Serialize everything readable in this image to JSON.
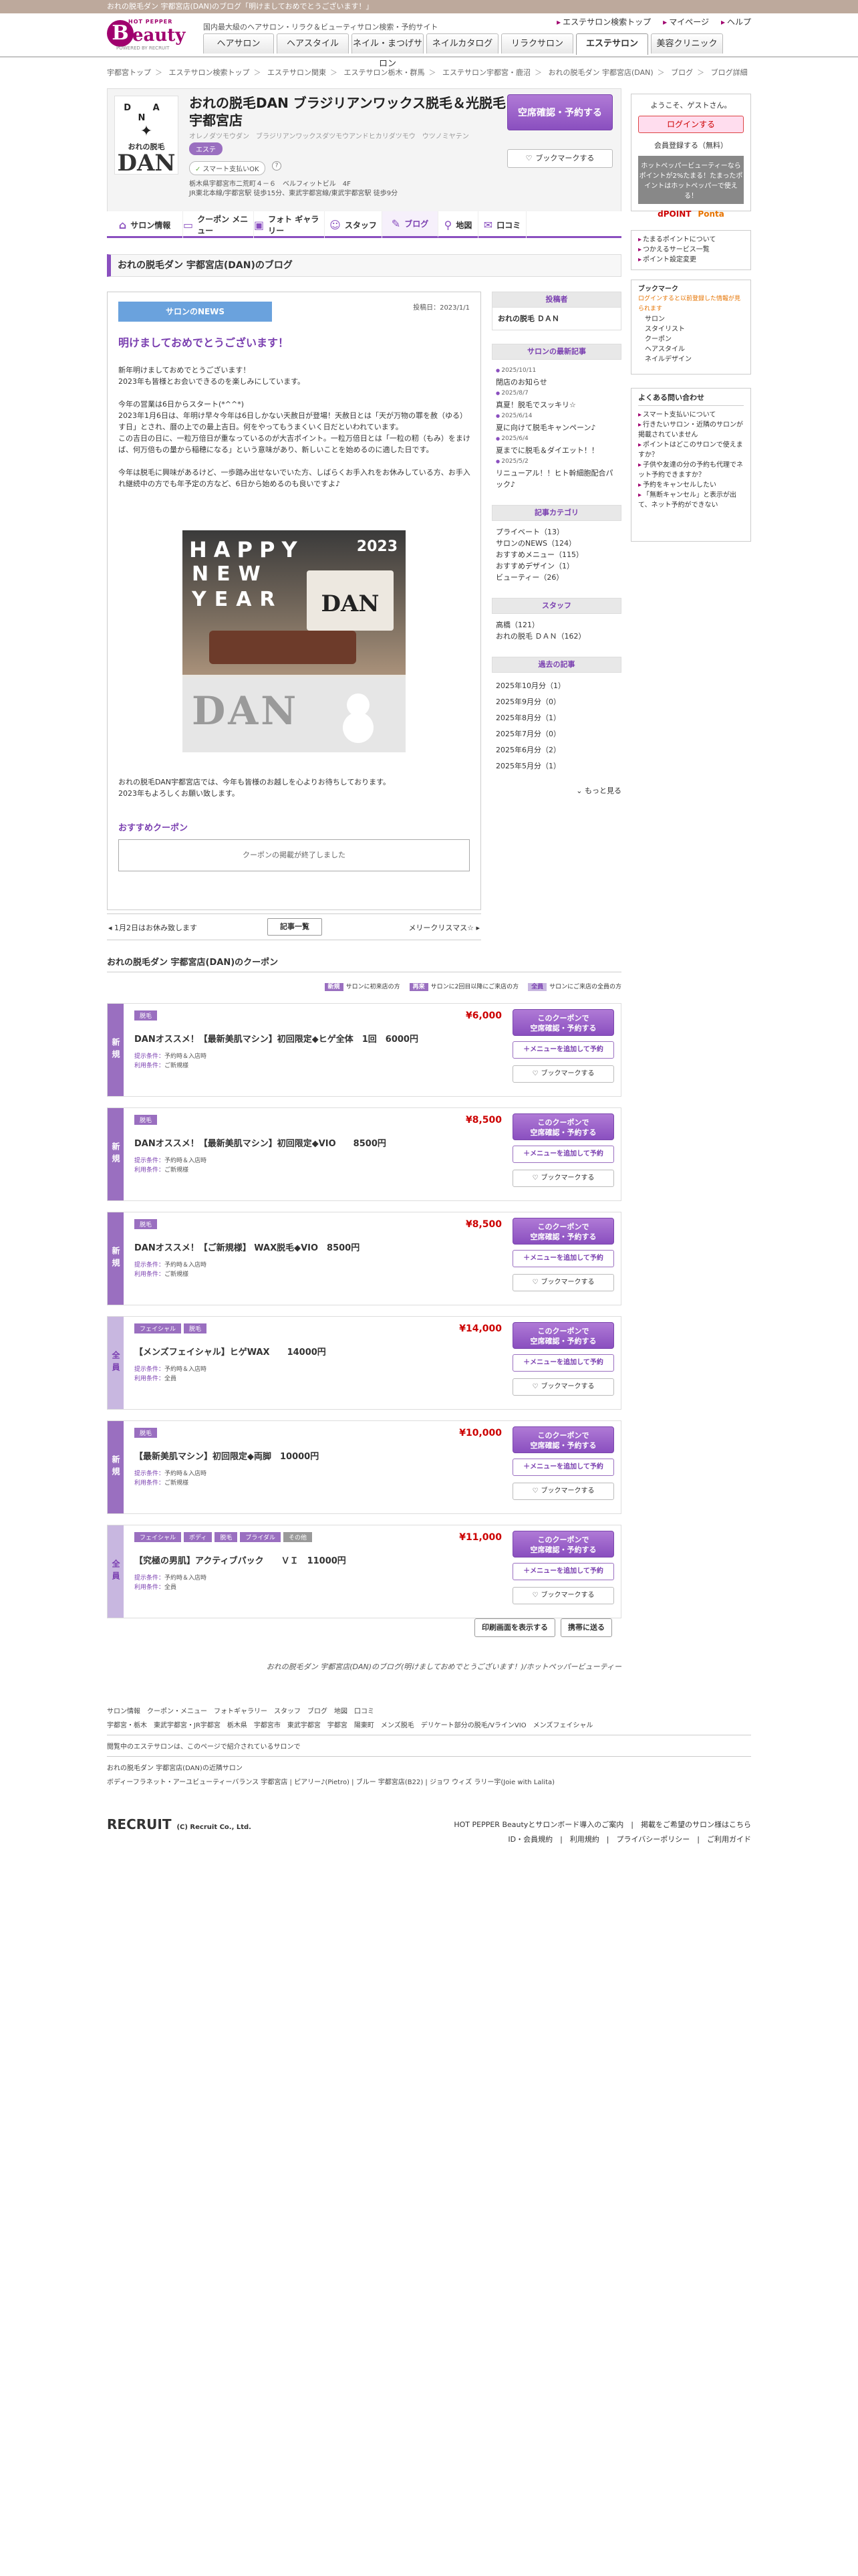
{
  "topbar": "おれの脱毛ダン 宇都宮店(DAN)のブログ「明けましておめでとうございます！」",
  "logo": {
    "hp": "HOT PEPPER",
    "beauty": "eauty",
    "b": "B",
    "powered": "POWERED BY RECRUIT"
  },
  "catch": "国内最大級のヘアサロン・リラク＆ビューティサロン検索・予約サイト",
  "headlinks": [
    "エステサロン検索トップ",
    "マイページ",
    "ヘルプ"
  ],
  "gnav": [
    "ヘアサロン",
    "ヘアスタイル",
    "ネイル・まつげサロン",
    "ネイルカタログ",
    "リラクサロン",
    "エステサロン",
    "美容クリニック"
  ],
  "breadcrumb": [
    "宇都宮トップ",
    "エステサロン検索トップ",
    "エステサロン関東",
    "エステサロン栃木・群馬",
    "エステサロン宇都宮・鹿沼",
    "おれの脱毛ダン 宇都宮店(DAN)",
    "ブログ",
    "ブログ詳細"
  ],
  "salon": {
    "name": "おれの脱毛DAN ブラジリアンワックス脱毛＆光脱毛 宇都宮店",
    "kana": "オレノダツモウダン　ブラジリアンワックスダツモウアンドヒカリダツモウ　ウツノミヤテン",
    "tag": "エステ",
    "smartpay": "スマート支払いOK",
    "address": "栃木県宇都宮市二荒町４－６　ベルフィットビル　4F",
    "access": "JR東北本線/宇都宮駅 徒歩15分、東武宇都宮線/東武宇都宮駅 徒歩9分",
    "reserve": "空席確認・予約する",
    "bookmark": "ブックマークする",
    "logo_top": "D A N",
    "logo_ore": "おれの脱毛",
    "logo_dan": "DAN"
  },
  "tabs": [
    {
      "label": "サロン情報",
      "icon": "⌂"
    },
    {
      "label": "クーポン メニュー",
      "icon": "▭"
    },
    {
      "label": "フォト ギャラリー",
      "icon": "▣"
    },
    {
      "label": "スタッフ",
      "icon": "☺"
    },
    {
      "label": "ブログ",
      "icon": "✎"
    },
    {
      "label": "地図",
      "icon": "⚲"
    },
    {
      "label": "口コミ",
      "icon": "✉"
    }
  ],
  "blog_heading": "おれの脱毛ダン 宇都宮店(DAN)のブログ",
  "article": {
    "category": "サロンのNEWS",
    "date": "投稿日：2023/1/1",
    "title": "明けましておめでとうございます！",
    "body": "新年明けましておめでとうございます！\n2023年も皆様とお会いできるのを楽しみにしています。\n\n今年の営業は6日からスタート(*^^*)\n2023年1月6日は、年明け早々今年は6日しかない天赦日が登場！天赦日とは「天が万物の罪を赦（ゆる）す日」とされ、暦の上での最上吉日。何をやってもうまくいく日だといわれています。\nこの吉日の日に、一粒万倍日が重なっているのが大吉ポイント。一粒万倍日とは「一粒の籾（もみ）をまけば、何万倍もの量から稲穂になる」という意味があり、新しいことを始めるのに適した日です。\n\n今年は脱毛に興味があるけど、一歩踏み出せないでいた方、しばらくお手入れをお休みしている方、お手入れ継続中の方でも年予定の方など、6日から始めるのも良いですよ♪",
    "photo": {
      "happy": "HAPPY",
      "new": "NEW",
      "year_word": "YEAR",
      "year": "2023",
      "sign": "DAN",
      "board": "DAN"
    },
    "footer": "おれの脱毛DAN宇都宮店では、今年も皆様のお越しを心よりお待ちしております。\n2023年もよろしくお願い致します。",
    "coupon_title": "おすすめクーポン",
    "coupon_ended": "クーポンの掲載が終了しました"
  },
  "pager": {
    "prev": "1月2日はお休み致します",
    "list": "記事一覧",
    "next": "メリークリスマス☆"
  },
  "sidebar": {
    "author_h": "投稿者",
    "author": "おれの脱毛 ＤＡＮ",
    "latest_h": "サロンの最新記事",
    "latest": [
      {
        "date": "2025/10/11",
        "title": "閉店のお知らせ"
      },
      {
        "date": "2025/8/7",
        "title": "真夏！脱毛でスッキリ☆"
      },
      {
        "date": "2025/6/14",
        "title": "夏に向けて脱毛キャンペーン♪"
      },
      {
        "date": "2025/6/4",
        "title": "夏までに脱毛＆ダイエット！！"
      },
      {
        "date": "2025/5/2",
        "title": "リニューアル！！ヒト幹細胞配合パック♪"
      }
    ],
    "cat_h": "記事カテゴリ",
    "cats": [
      "プライベート（13）",
      "サロンのNEWS（124）",
      "おすすめメニュー（115）",
      "おすすめデザイン（1）",
      "ビューティー（26）"
    ],
    "staff_h": "スタッフ",
    "staff": [
      "高橋（121）",
      "おれの脱毛 ＤＡＮ（162）"
    ],
    "past_h": "過去の記事",
    "past": [
      "2025年10月分（1）",
      "2025年9月分（0）",
      "2025年8月分（1）",
      "2025年7月分（0）",
      "2025年6月分（2）",
      "2025年5月分（1）"
    ],
    "more": "もっと見る"
  },
  "right": {
    "welcome": "ようこそ、ゲストさん。",
    "login": "ログインする",
    "register": "会員登録する（無料）",
    "promo": "ホットペッパービューティーならポイントが2%たまる！たまったポイントはホットペッパーで使える！",
    "pt1": "Ponta",
    "pt2": "dPOINT",
    "links": [
      "たまるポイントについて",
      "つかえるサービス一覧",
      "ポイント設定変更"
    ],
    "bm_h": "ブックマーク",
    "bm_note": "ログインすると以前登録した情報が見られます",
    "bm_items": [
      "サロン",
      "スタイリスト",
      "クーポン",
      "ヘアスタイル",
      "ネイルデザイン"
    ],
    "faq_h": "よくある問い合わせ",
    "faq": [
      "スマート支払いについて",
      "行きたいサロン・近隣のサロンが掲載されていません",
      "ポイントはどこのサロンで使えますか？",
      "子供や友達の分の予約も代理でネット予約できますか？",
      "予約をキャンセルしたい",
      "「無断キャンセル」と表示が出て、ネット予約ができない"
    ]
  },
  "coupons": {
    "title": "おれの脱毛ダン 宇都宮店(DAN)のクーポン",
    "legend": [
      {
        "tag": "新規",
        "text": "サロンに初来店の方"
      },
      {
        "tag": "再来",
        "text": "サロンに2回目以降にご来店の方"
      },
      {
        "tag": "全員",
        "text": "サロンにご来店の全員の方"
      }
    ],
    "btn": "このクーポンで\n空席確認・予約する",
    "add": "＋メニューを追加して予約",
    "bookmark": "ブックマークする",
    "cond_label1": "提示条件：",
    "cond_label2": "利用条件：",
    "items": [
      {
        "kind": "新規",
        "tags": [
          "脱毛"
        ],
        "price": "¥6,000",
        "name": "DANオススメ！【最新美肌マシン】初回限定◆ヒゲ全体　1回　6000円",
        "cond1": "予約時＆入店時",
        "cond2": "ご新規様"
      },
      {
        "kind": "新規",
        "tags": [
          "脱毛"
        ],
        "price": "¥8,500",
        "name": "DANオススメ！【最新美肌マシン】初回限定◆VIO　　8500円",
        "cond1": "予約時＆入店時",
        "cond2": "ご新規様"
      },
      {
        "kind": "新規",
        "tags": [
          "脱毛"
        ],
        "price": "¥8,500",
        "name": "DANオススメ！【ご新規様】 WAX脱毛◆VIO　8500円",
        "cond1": "予約時＆入店時",
        "cond2": "ご新規様"
      },
      {
        "kind": "全員",
        "tags": [
          "フェイシャル",
          "脱毛"
        ],
        "price": "¥14,000",
        "name": "【メンズフェイシャル】ヒゲWAX　　14000円",
        "cond1": "予約時＆入店時",
        "cond2": "全員"
      },
      {
        "kind": "新規",
        "tags": [
          "脱毛"
        ],
        "price": "¥10,000",
        "name": "【最新美肌マシン】初回限定◆両脚　10000円",
        "cond1": "予約時＆入店時",
        "cond2": "ご新規様"
      },
      {
        "kind": "全員",
        "tags": [
          "フェイシャル",
          "ボディ",
          "脱毛",
          "ブライダル",
          "その他"
        ],
        "price": "¥11,000",
        "name": "【究極の男肌】アクティブパック　　ＶＩ　11000円",
        "cond1": "予約時＆入店時",
        "cond2": "全員"
      }
    ]
  },
  "print_btns": [
    "印刷画面を表示する",
    "携帯に送る"
  ],
  "tagline": "おれの脱毛ダン 宇都宮店(DAN)のブログ(明けましておめでとうございます！)/ホットペッパービューティー",
  "footer": {
    "row1": [
      "サロン情報",
      "クーポン・メニュー",
      "フォトギャラリー",
      "スタッフ",
      "ブログ",
      "地図",
      "口コミ"
    ],
    "row2": [
      "宇都宮・栃木",
      "東武宇都宮・JR宇都宮",
      "栃木県",
      "宇都宮市",
      "東武宇都宮",
      "宇都宮",
      "陽東町",
      "メンズ脱毛",
      "デリケート部分の脱毛/VラインVIO",
      "メンズフェイシャル"
    ],
    "row3": "閲覧中のエステサロンは、このページで紹介されているサロンで",
    "row4": "おれの脱毛ダン 宇都宮店(DAN)の近隣サロン",
    "row5": "ボディーフラネット・アーユビューティーバランス 宇都宮店 | ピアリー♪(Pietro) | ブルー 宇都宮店(B22) | ジョワ ウィズ ラリー宇(Joie with Lalita)",
    "recruit": "RECRUIT",
    "copy": "(C) Recruit Co., Ltd.",
    "links1": "HOT PEPPER Beautyとサロンボード導入のご案内　|　掲載をご希望のサロン様はこちら",
    "links2": "ID・会員規約　|　利用規約　|　プライバシーポリシー　|　ご利用ガイド"
  }
}
